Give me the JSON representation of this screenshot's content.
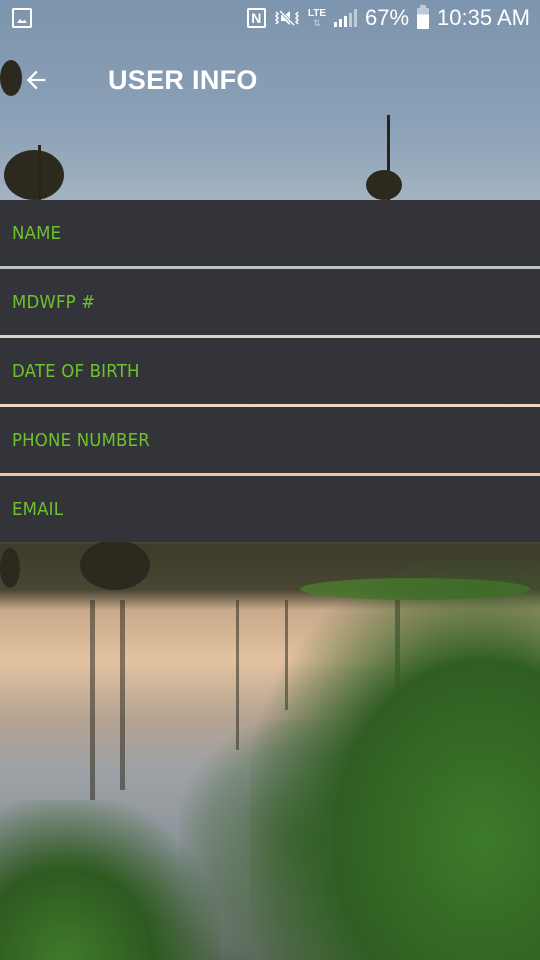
{
  "status_bar": {
    "left_icons": [
      "gallery-icon"
    ],
    "right_icons": [
      "nfc-icon",
      "vibrate-mute-icon",
      "lte-icon",
      "signal-icon"
    ],
    "lte_label": "LTE",
    "battery_percent": "67%",
    "battery_level": 0.67,
    "time": "10:35 AM"
  },
  "app_bar": {
    "back_icon": "arrow-left-icon",
    "title": "USER INFO"
  },
  "info_rows": [
    {
      "label": "NAME"
    },
    {
      "label": "MDWFP #"
    },
    {
      "label": "DATE OF BIRTH"
    },
    {
      "label": "PHONE NUMBER"
    },
    {
      "label": "EMAIL"
    }
  ],
  "colors": {
    "row_background": "#333439",
    "label_accent": "#6ec22c",
    "title_text": "#ffffff"
  }
}
